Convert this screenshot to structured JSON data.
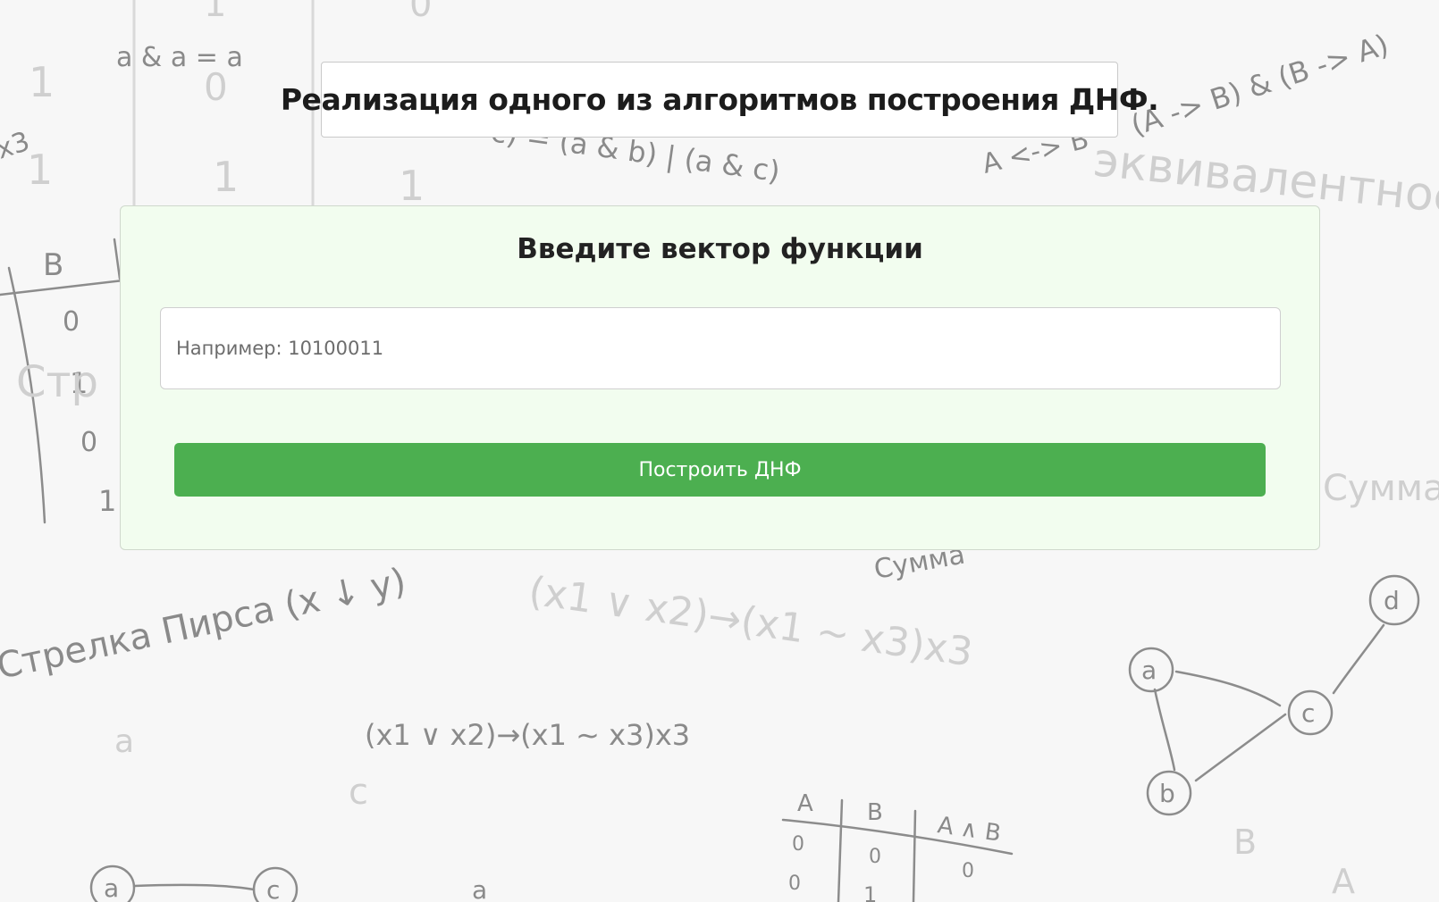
{
  "page": {
    "title": "Реализация одного из алгоритмов построения ДНФ."
  },
  "form": {
    "heading": "Введите вектор функции",
    "vector_placeholder": "Например: 10100011",
    "vector_value": "",
    "submit_label": "Построить ДНФ"
  },
  "background": {
    "formulas": {
      "idempotence": "a & a = a",
      "distributive_tail": "c) = (a & b) | (a & c)",
      "equivalence": "A <-> B",
      "equivalence_expansion": "(A -> B) & (B -> A)",
      "equivalence_word": "эквивалентность",
      "x3_fragment": "x3",
      "peirce_arrow": "Стрелка Пирса (x ↓ y)",
      "formula_main": "(x1 ∨ x2)→(x1 ~ x3)x3",
      "formula_blurred": "(x1 ∨ x2)→(x1 ~ x3)x3",
      "sum_fragment": "Сумма",
      "sum_fragment_blurred": "Сумма",
      "arrow_fragment_blurred": "Стр"
    },
    "truth_table_left": {
      "header": "B",
      "values": [
        "0",
        "1",
        "0",
        "1"
      ]
    },
    "truth_table_bottom": {
      "headers": [
        "A",
        "B",
        "A ∧ B"
      ],
      "rows": [
        [
          "0",
          "0",
          "0"
        ],
        [
          "0",
          "1",
          ""
        ]
      ]
    },
    "graph_right_nodes": [
      "a",
      "b",
      "c",
      "d"
    ],
    "graph_bottom_nodes": [
      "a",
      "c"
    ],
    "blurred_digits": [
      "1",
      "0",
      "1",
      "0",
      "1",
      "1",
      "1"
    ],
    "stray_letters": [
      "a",
      "c",
      "a",
      "B",
      "A"
    ],
    "colors": {
      "stroke": "#8a8a8a",
      "blurred": "#cfcfcf",
      "card_background": "#f2fdef",
      "button": "#4caf50"
    }
  }
}
